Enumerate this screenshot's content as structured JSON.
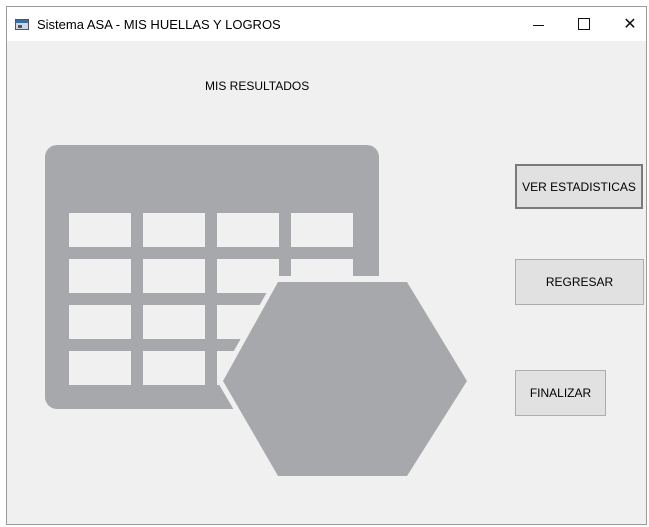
{
  "window": {
    "title": "Sistema ASA - MIS HUELLAS Y LOGROS",
    "controls": {
      "minimize_glyph": "minimize-icon",
      "maximize_glyph": "maximize-icon",
      "close_label": "✕"
    }
  },
  "main": {
    "heading": "MIS RESULTADOS",
    "illustration": {
      "icon": "calendar-grid-with-hexagon-icon",
      "fill_color": "#a7a8ab"
    }
  },
  "actions": {
    "ver_estadisticas": "VER ESTADISTICAS",
    "regresar": "REGRESAR",
    "finalizar": "FINALIZAR"
  },
  "colors": {
    "window_bg": "#f0f0f0",
    "button_bg": "#e1e1e1",
    "button_border": "#adadad"
  }
}
